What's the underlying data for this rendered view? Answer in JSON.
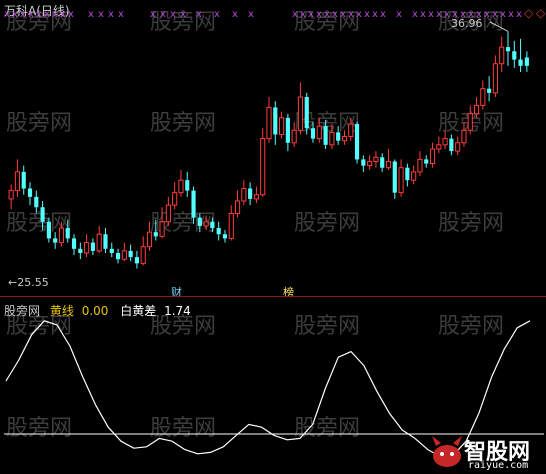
{
  "window": {
    "title": "万科A(日线)",
    "watermark": "股旁网"
  },
  "kline": {
    "high_label": "36.96",
    "low_label": "25.55",
    "high_price": 36.96,
    "low_price": 25.55,
    "signal_marker": "x",
    "badges": {
      "cai": "财",
      "bang": "榜"
    },
    "candles": [
      {
        "o": 28.9,
        "c": 29.3,
        "h": 29.6,
        "l": 28.4,
        "up": true
      },
      {
        "o": 29.3,
        "c": 30.2,
        "h": 30.8,
        "l": 29.0,
        "up": true
      },
      {
        "o": 30.2,
        "c": 29.4,
        "h": 30.5,
        "l": 29.1,
        "up": false
      },
      {
        "o": 29.4,
        "c": 29.0,
        "h": 29.7,
        "l": 28.6,
        "up": false
      },
      {
        "o": 29.0,
        "c": 28.5,
        "h": 29.3,
        "l": 28.2,
        "up": false
      },
      {
        "o": 28.5,
        "c": 27.8,
        "h": 28.8,
        "l": 27.4,
        "up": false
      },
      {
        "o": 27.8,
        "c": 27.0,
        "h": 28.0,
        "l": 26.8,
        "up": false
      },
      {
        "o": 27.0,
        "c": 26.8,
        "h": 27.3,
        "l": 26.5,
        "up": false
      },
      {
        "o": 26.8,
        "c": 27.5,
        "h": 27.8,
        "l": 26.6,
        "up": true
      },
      {
        "o": 27.5,
        "c": 27.0,
        "h": 27.9,
        "l": 26.8,
        "up": false
      },
      {
        "o": 27.0,
        "c": 26.5,
        "h": 27.2,
        "l": 26.2,
        "up": false
      },
      {
        "o": 26.5,
        "c": 26.3,
        "h": 26.8,
        "l": 26.0,
        "up": false
      },
      {
        "o": 26.3,
        "c": 26.8,
        "h": 27.2,
        "l": 26.1,
        "up": true
      },
      {
        "o": 26.8,
        "c": 26.4,
        "h": 27.0,
        "l": 26.2,
        "up": false
      },
      {
        "o": 26.4,
        "c": 27.2,
        "h": 27.6,
        "l": 26.3,
        "up": true
      },
      {
        "o": 27.2,
        "c": 26.5,
        "h": 27.5,
        "l": 26.3,
        "up": false
      },
      {
        "o": 26.5,
        "c": 26.3,
        "h": 26.8,
        "l": 26.1,
        "up": false
      },
      {
        "o": 26.3,
        "c": 26.0,
        "h": 26.5,
        "l": 25.8,
        "up": false
      },
      {
        "o": 26.0,
        "c": 26.4,
        "h": 26.8,
        "l": 25.9,
        "up": true
      },
      {
        "o": 26.4,
        "c": 26.1,
        "h": 26.7,
        "l": 25.9,
        "up": false
      },
      {
        "o": 26.1,
        "c": 25.8,
        "h": 26.4,
        "l": 25.55,
        "up": false
      },
      {
        "o": 25.8,
        "c": 26.6,
        "h": 27.1,
        "l": 25.7,
        "up": true
      },
      {
        "o": 26.6,
        "c": 27.3,
        "h": 27.8,
        "l": 26.4,
        "up": true
      },
      {
        "o": 27.3,
        "c": 27.1,
        "h": 27.9,
        "l": 26.9,
        "up": false
      },
      {
        "o": 27.1,
        "c": 27.8,
        "h": 28.5,
        "l": 27.0,
        "up": true
      },
      {
        "o": 27.8,
        "c": 28.6,
        "h": 29.0,
        "l": 27.6,
        "up": true
      },
      {
        "o": 28.6,
        "c": 29.2,
        "h": 29.7,
        "l": 28.4,
        "up": true
      },
      {
        "o": 29.2,
        "c": 29.8,
        "h": 30.3,
        "l": 29.0,
        "up": true
      },
      {
        "o": 29.8,
        "c": 29.3,
        "h": 30.2,
        "l": 29.0,
        "up": false
      },
      {
        "o": 29.3,
        "c": 28.0,
        "h": 29.5,
        "l": 27.7,
        "up": false
      },
      {
        "o": 28.0,
        "c": 27.6,
        "h": 28.2,
        "l": 27.3,
        "up": false
      },
      {
        "o": 27.6,
        "c": 27.8,
        "h": 28.1,
        "l": 27.4,
        "up": true
      },
      {
        "o": 27.8,
        "c": 27.5,
        "h": 28.0,
        "l": 27.3,
        "up": false
      },
      {
        "o": 27.5,
        "c": 27.2,
        "h": 27.8,
        "l": 26.9,
        "up": false
      },
      {
        "o": 27.2,
        "c": 27.0,
        "h": 27.4,
        "l": 26.8,
        "up": false
      },
      {
        "o": 27.0,
        "c": 28.2,
        "h": 28.6,
        "l": 26.9,
        "up": true
      },
      {
        "o": 28.2,
        "c": 28.8,
        "h": 29.3,
        "l": 28.0,
        "up": true
      },
      {
        "o": 28.8,
        "c": 29.4,
        "h": 29.8,
        "l": 28.6,
        "up": true
      },
      {
        "o": 29.4,
        "c": 28.9,
        "h": 29.7,
        "l": 28.6,
        "up": false
      },
      {
        "o": 28.9,
        "c": 29.1,
        "h": 29.5,
        "l": 28.7,
        "up": true
      },
      {
        "o": 29.1,
        "c": 31.8,
        "h": 32.3,
        "l": 29.0,
        "up": true
      },
      {
        "o": 31.8,
        "c": 33.3,
        "h": 33.8,
        "l": 31.6,
        "up": true
      },
      {
        "o": 33.3,
        "c": 32.0,
        "h": 33.6,
        "l": 31.5,
        "up": false
      },
      {
        "o": 32.0,
        "c": 32.8,
        "h": 33.1,
        "l": 31.8,
        "up": true
      },
      {
        "o": 32.8,
        "c": 31.6,
        "h": 33.0,
        "l": 31.2,
        "up": false
      },
      {
        "o": 31.6,
        "c": 32.2,
        "h": 32.6,
        "l": 31.4,
        "up": true
      },
      {
        "o": 32.2,
        "c": 33.8,
        "h": 34.5,
        "l": 32.0,
        "up": true
      },
      {
        "o": 33.8,
        "c": 32.3,
        "h": 34.0,
        "l": 32.0,
        "up": false
      },
      {
        "o": 32.3,
        "c": 31.8,
        "h": 32.6,
        "l": 31.6,
        "up": false
      },
      {
        "o": 31.8,
        "c": 32.4,
        "h": 32.8,
        "l": 31.6,
        "up": true
      },
      {
        "o": 32.4,
        "c": 31.5,
        "h": 32.7,
        "l": 31.3,
        "up": false
      },
      {
        "o": 31.5,
        "c": 32.1,
        "h": 32.5,
        "l": 31.3,
        "up": true
      },
      {
        "o": 32.1,
        "c": 31.7,
        "h": 32.4,
        "l": 31.5,
        "up": false
      },
      {
        "o": 31.7,
        "c": 31.9,
        "h": 32.2,
        "l": 31.5,
        "up": true
      },
      {
        "o": 31.9,
        "c": 32.5,
        "h": 32.8,
        "l": 31.7,
        "up": true
      },
      {
        "o": 32.5,
        "c": 30.8,
        "h": 32.6,
        "l": 30.6,
        "up": false
      },
      {
        "o": 30.8,
        "c": 30.5,
        "h": 31.0,
        "l": 30.2,
        "up": false
      },
      {
        "o": 30.5,
        "c": 30.7,
        "h": 31.0,
        "l": 30.3,
        "up": true
      },
      {
        "o": 30.7,
        "c": 30.9,
        "h": 31.2,
        "l": 30.4,
        "up": true
      },
      {
        "o": 30.9,
        "c": 30.4,
        "h": 31.1,
        "l": 30.2,
        "up": false
      },
      {
        "o": 30.4,
        "c": 30.7,
        "h": 31.3,
        "l": 30.3,
        "up": true
      },
      {
        "o": 30.7,
        "c": 29.2,
        "h": 30.8,
        "l": 28.9,
        "up": false
      },
      {
        "o": 29.2,
        "c": 30.4,
        "h": 30.8,
        "l": 29.0,
        "up": true
      },
      {
        "o": 30.4,
        "c": 29.8,
        "h": 30.6,
        "l": 29.5,
        "up": false
      },
      {
        "o": 29.8,
        "c": 30.2,
        "h": 30.5,
        "l": 29.6,
        "up": true
      },
      {
        "o": 30.2,
        "c": 30.8,
        "h": 31.2,
        "l": 30.0,
        "up": true
      },
      {
        "o": 30.8,
        "c": 30.6,
        "h": 31.0,
        "l": 30.4,
        "up": false
      },
      {
        "o": 30.6,
        "c": 31.3,
        "h": 31.6,
        "l": 30.4,
        "up": true
      },
      {
        "o": 31.3,
        "c": 31.5,
        "h": 31.9,
        "l": 31.1,
        "up": true
      },
      {
        "o": 31.5,
        "c": 31.8,
        "h": 32.2,
        "l": 31.3,
        "up": true
      },
      {
        "o": 31.8,
        "c": 31.2,
        "h": 32.0,
        "l": 31.0,
        "up": false
      },
      {
        "o": 31.2,
        "c": 31.6,
        "h": 31.9,
        "l": 31.0,
        "up": true
      },
      {
        "o": 31.6,
        "c": 32.2,
        "h": 32.6,
        "l": 31.4,
        "up": true
      },
      {
        "o": 32.2,
        "c": 33.0,
        "h": 33.4,
        "l": 32.0,
        "up": true
      },
      {
        "o": 33.0,
        "c": 33.4,
        "h": 33.8,
        "l": 32.8,
        "up": true
      },
      {
        "o": 33.4,
        "c": 34.2,
        "h": 34.6,
        "l": 33.2,
        "up": true
      },
      {
        "o": 34.2,
        "c": 34.0,
        "h": 34.8,
        "l": 33.6,
        "up": false
      },
      {
        "o": 34.0,
        "c": 35.4,
        "h": 35.8,
        "l": 33.8,
        "up": true
      },
      {
        "o": 35.4,
        "c": 36.2,
        "h": 36.7,
        "l": 35.0,
        "up": true
      },
      {
        "o": 36.2,
        "c": 36.0,
        "h": 36.96,
        "l": 35.3,
        "up": false
      },
      {
        "o": 36.0,
        "c": 35.6,
        "h": 36.5,
        "l": 35.2,
        "up": false
      },
      {
        "o": 35.6,
        "c": 35.3,
        "h": 36.6,
        "l": 35.0,
        "up": false
      },
      {
        "o": 35.3,
        "c": 35.7,
        "h": 36.0,
        "l": 35.0,
        "up": false
      }
    ]
  },
  "indicator": {
    "name": "股旁网",
    "yellow_label": "黄线",
    "yellow_value": "0.00",
    "white_label": "白黄差",
    "white_value": "1.74",
    "white_line": [
      0.55,
      0.7,
      0.88,
      0.98,
      0.95,
      0.8,
      0.58,
      0.38,
      0.22,
      0.12,
      0.07,
      0.08,
      0.14,
      0.12,
      0.06,
      0.03,
      0.04,
      0.08,
      0.16,
      0.24,
      0.22,
      0.16,
      0.13,
      0.14,
      0.24,
      0.5,
      0.72,
      0.76,
      0.66,
      0.48,
      0.32,
      0.2,
      0.14,
      0.06,
      0.01,
      0.02,
      0.12,
      0.32,
      0.58,
      0.78,
      0.93,
      0.98
    ]
  },
  "logo": {
    "text": "智股网",
    "url": "raiyue.com"
  },
  "colors": {
    "up": "#ff3c3c",
    "down": "#54ffff",
    "white_line": "#ffffff",
    "yellow_line": "#e6c200",
    "signal": "#b04cd6"
  }
}
